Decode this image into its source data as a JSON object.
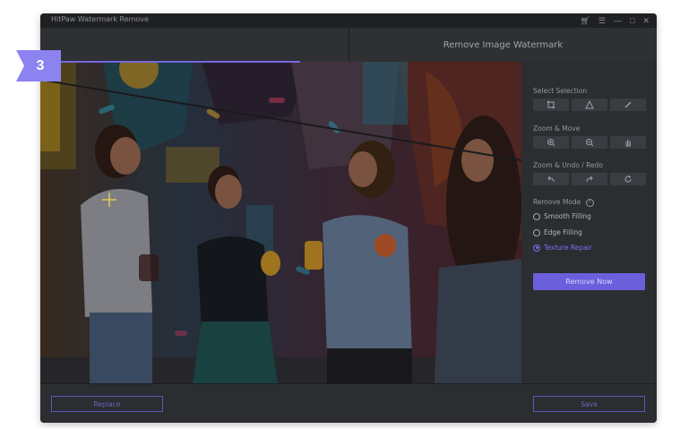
{
  "window": {
    "title": "HitPaw Watermark Remove"
  },
  "header": {
    "title": "Remove Image Watermark"
  },
  "badge": {
    "step": "3"
  },
  "panel": {
    "select_selection": {
      "label": "Select Selection",
      "tools": [
        "rectangle-icon",
        "polygon-icon",
        "brush-icon"
      ]
    },
    "zoom_move": {
      "label": "Zoom & Move",
      "tools": [
        "zoom-in-icon",
        "zoom-out-icon",
        "hand-icon"
      ]
    },
    "zoom_undo_redo": {
      "label": "Zoom & Undo / Redo",
      "tools": [
        "undo-icon",
        "redo-icon",
        "reset-icon"
      ]
    },
    "remove_mode": {
      "label": "Remove Mode",
      "options": [
        {
          "label": "Smooth Filling",
          "selected": false
        },
        {
          "label": "Edge Filling",
          "selected": false
        },
        {
          "label": "Texture Repair",
          "selected": true
        }
      ]
    },
    "remove_button": "Remove Now"
  },
  "footer": {
    "replace_label": "Replace",
    "save_label": "Save"
  },
  "colors": {
    "accent": "#6b5fdc",
    "badge": "#8c83f0",
    "window_bg": "#2b2d31"
  }
}
